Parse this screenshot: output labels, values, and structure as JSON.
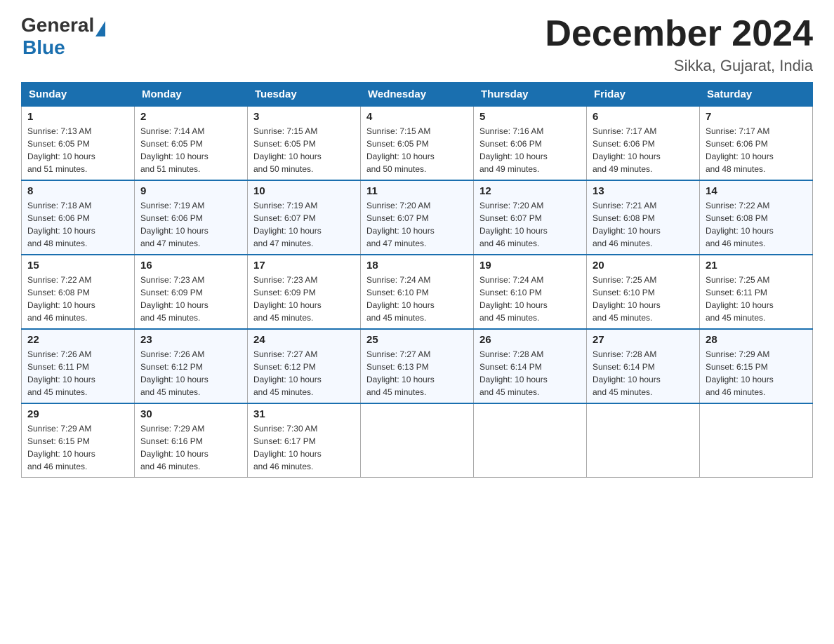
{
  "header": {
    "logo_general": "General",
    "logo_blue": "Blue",
    "month_title": "December 2024",
    "location": "Sikka, Gujarat, India"
  },
  "days_of_week": [
    "Sunday",
    "Monday",
    "Tuesday",
    "Wednesday",
    "Thursday",
    "Friday",
    "Saturday"
  ],
  "weeks": [
    [
      {
        "day": "1",
        "sunrise": "7:13 AM",
        "sunset": "6:05 PM",
        "daylight": "10 hours and 51 minutes."
      },
      {
        "day": "2",
        "sunrise": "7:14 AM",
        "sunset": "6:05 PM",
        "daylight": "10 hours and 51 minutes."
      },
      {
        "day": "3",
        "sunrise": "7:15 AM",
        "sunset": "6:05 PM",
        "daylight": "10 hours and 50 minutes."
      },
      {
        "day": "4",
        "sunrise": "7:15 AM",
        "sunset": "6:05 PM",
        "daylight": "10 hours and 50 minutes."
      },
      {
        "day": "5",
        "sunrise": "7:16 AM",
        "sunset": "6:06 PM",
        "daylight": "10 hours and 49 minutes."
      },
      {
        "day": "6",
        "sunrise": "7:17 AM",
        "sunset": "6:06 PM",
        "daylight": "10 hours and 49 minutes."
      },
      {
        "day": "7",
        "sunrise": "7:17 AM",
        "sunset": "6:06 PM",
        "daylight": "10 hours and 48 minutes."
      }
    ],
    [
      {
        "day": "8",
        "sunrise": "7:18 AM",
        "sunset": "6:06 PM",
        "daylight": "10 hours and 48 minutes."
      },
      {
        "day": "9",
        "sunrise": "7:19 AM",
        "sunset": "6:06 PM",
        "daylight": "10 hours and 47 minutes."
      },
      {
        "day": "10",
        "sunrise": "7:19 AM",
        "sunset": "6:07 PM",
        "daylight": "10 hours and 47 minutes."
      },
      {
        "day": "11",
        "sunrise": "7:20 AM",
        "sunset": "6:07 PM",
        "daylight": "10 hours and 47 minutes."
      },
      {
        "day": "12",
        "sunrise": "7:20 AM",
        "sunset": "6:07 PM",
        "daylight": "10 hours and 46 minutes."
      },
      {
        "day": "13",
        "sunrise": "7:21 AM",
        "sunset": "6:08 PM",
        "daylight": "10 hours and 46 minutes."
      },
      {
        "day": "14",
        "sunrise": "7:22 AM",
        "sunset": "6:08 PM",
        "daylight": "10 hours and 46 minutes."
      }
    ],
    [
      {
        "day": "15",
        "sunrise": "7:22 AM",
        "sunset": "6:08 PM",
        "daylight": "10 hours and 46 minutes."
      },
      {
        "day": "16",
        "sunrise": "7:23 AM",
        "sunset": "6:09 PM",
        "daylight": "10 hours and 45 minutes."
      },
      {
        "day": "17",
        "sunrise": "7:23 AM",
        "sunset": "6:09 PM",
        "daylight": "10 hours and 45 minutes."
      },
      {
        "day": "18",
        "sunrise": "7:24 AM",
        "sunset": "6:10 PM",
        "daylight": "10 hours and 45 minutes."
      },
      {
        "day": "19",
        "sunrise": "7:24 AM",
        "sunset": "6:10 PM",
        "daylight": "10 hours and 45 minutes."
      },
      {
        "day": "20",
        "sunrise": "7:25 AM",
        "sunset": "6:10 PM",
        "daylight": "10 hours and 45 minutes."
      },
      {
        "day": "21",
        "sunrise": "7:25 AM",
        "sunset": "6:11 PM",
        "daylight": "10 hours and 45 minutes."
      }
    ],
    [
      {
        "day": "22",
        "sunrise": "7:26 AM",
        "sunset": "6:11 PM",
        "daylight": "10 hours and 45 minutes."
      },
      {
        "day": "23",
        "sunrise": "7:26 AM",
        "sunset": "6:12 PM",
        "daylight": "10 hours and 45 minutes."
      },
      {
        "day": "24",
        "sunrise": "7:27 AM",
        "sunset": "6:12 PM",
        "daylight": "10 hours and 45 minutes."
      },
      {
        "day": "25",
        "sunrise": "7:27 AM",
        "sunset": "6:13 PM",
        "daylight": "10 hours and 45 minutes."
      },
      {
        "day": "26",
        "sunrise": "7:28 AM",
        "sunset": "6:14 PM",
        "daylight": "10 hours and 45 minutes."
      },
      {
        "day": "27",
        "sunrise": "7:28 AM",
        "sunset": "6:14 PM",
        "daylight": "10 hours and 45 minutes."
      },
      {
        "day": "28",
        "sunrise": "7:29 AM",
        "sunset": "6:15 PM",
        "daylight": "10 hours and 46 minutes."
      }
    ],
    [
      {
        "day": "29",
        "sunrise": "7:29 AM",
        "sunset": "6:15 PM",
        "daylight": "10 hours and 46 minutes."
      },
      {
        "day": "30",
        "sunrise": "7:29 AM",
        "sunset": "6:16 PM",
        "daylight": "10 hours and 46 minutes."
      },
      {
        "day": "31",
        "sunrise": "7:30 AM",
        "sunset": "6:17 PM",
        "daylight": "10 hours and 46 minutes."
      },
      null,
      null,
      null,
      null
    ]
  ],
  "labels": {
    "sunrise": "Sunrise: ",
    "sunset": "Sunset: ",
    "daylight": "Daylight: "
  }
}
